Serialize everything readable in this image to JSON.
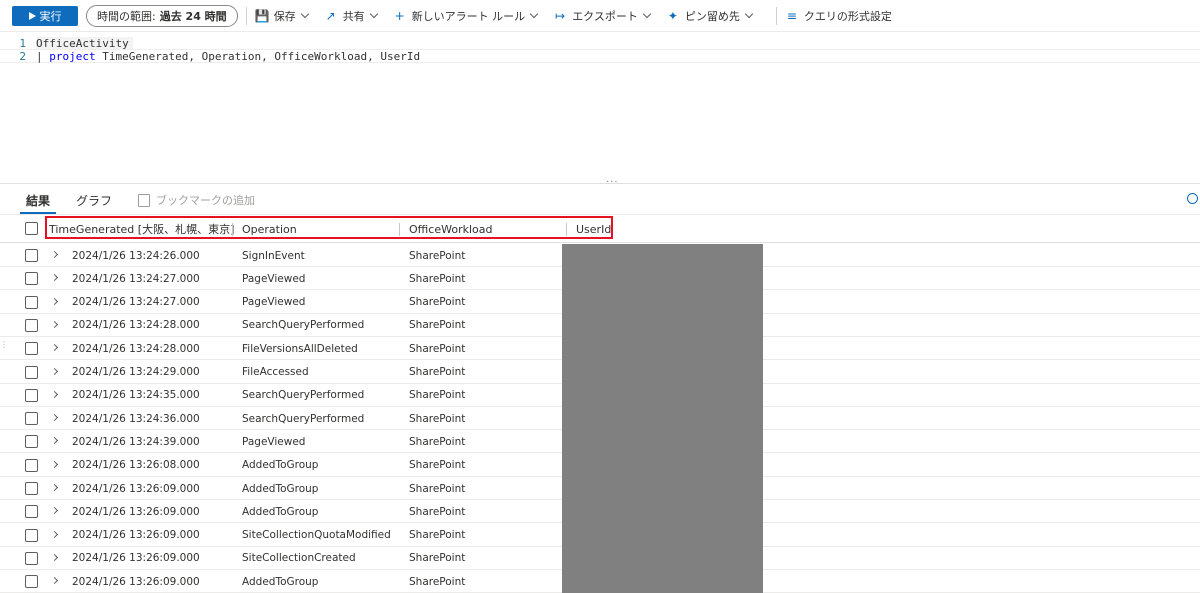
{
  "toolbar": {
    "run_label": "実行",
    "time_range_label": "時間の範囲:",
    "time_range_value": "過去 24 時間",
    "save_label": "保存",
    "share_label": "共有",
    "new_alert_label": "新しいアラート ルール",
    "export_label": "エクスポート",
    "pin_label": "ピン留め先",
    "format_label": "クエリの形式設定"
  },
  "editor": {
    "lines": [
      {
        "num": "1",
        "text": "OfficeActivity"
      },
      {
        "num": "2",
        "prefix": "| ",
        "keyword": "project",
        "text": " TimeGenerated, Operation, OfficeWorkload, UserId"
      }
    ]
  },
  "tabs": {
    "results": "結果",
    "chart": "グラフ",
    "bookmark": "ブックマークの追加"
  },
  "grid": {
    "columns": [
      "TimeGenerated [大阪、札幌、東京]",
      "Operation",
      "OfficeWorkload",
      "UserId"
    ],
    "rows": [
      [
        "2024/1/26 13:24:26.000",
        "SignInEvent",
        "SharePoint"
      ],
      [
        "2024/1/26 13:24:27.000",
        "PageViewed",
        "SharePoint"
      ],
      [
        "2024/1/26 13:24:27.000",
        "PageViewed",
        "SharePoint"
      ],
      [
        "2024/1/26 13:24:28.000",
        "SearchQueryPerformed",
        "SharePoint"
      ],
      [
        "2024/1/26 13:24:28.000",
        "FileVersionsAllDeleted",
        "SharePoint"
      ],
      [
        "2024/1/26 13:24:29.000",
        "FileAccessed",
        "SharePoint"
      ],
      [
        "2024/1/26 13:24:35.000",
        "SearchQueryPerformed",
        "SharePoint"
      ],
      [
        "2024/1/26 13:24:36.000",
        "SearchQueryPerformed",
        "SharePoint"
      ],
      [
        "2024/1/26 13:24:39.000",
        "PageViewed",
        "SharePoint"
      ],
      [
        "2024/1/26 13:26:08.000",
        "AddedToGroup",
        "SharePoint"
      ],
      [
        "2024/1/26 13:26:09.000",
        "AddedToGroup",
        "SharePoint"
      ],
      [
        "2024/1/26 13:26:09.000",
        "AddedToGroup",
        "SharePoint"
      ],
      [
        "2024/1/26 13:26:09.000",
        "SiteCollectionQuotaModified",
        "SharePoint"
      ],
      [
        "2024/1/26 13:26:09.000",
        "SiteCollectionCreated",
        "SharePoint"
      ],
      [
        "2024/1/26 13:26:09.000",
        "AddedToGroup",
        "SharePoint"
      ]
    ]
  },
  "colors": {
    "accent": "#0f6cbd",
    "highlight_border": "#e81123",
    "redaction": "#808080"
  }
}
